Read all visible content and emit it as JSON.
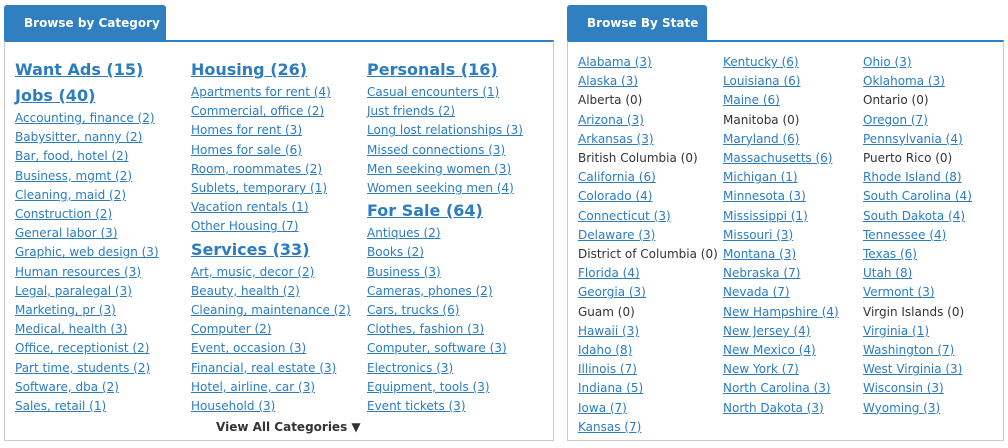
{
  "category_panel": {
    "tab_label": "Browse by Category",
    "view_all_label": "View All Categories",
    "columns": [
      [
        {
          "heading": "Want Ads (15)",
          "items": []
        },
        {
          "heading": "Jobs (40)",
          "items": [
            "Accounting, finance (2)",
            "Babysitter, nanny (2)",
            "Bar, food, hotel (2)",
            "Business, mgmt (2)",
            "Cleaning, maid (2)",
            "Construction (2)",
            "General labor (3)",
            "Graphic, web design (3)",
            "Human resources (3)",
            "Legal, paralegal (3)",
            "Marketing, pr (3)",
            "Medical, health (3)",
            "Office, receptionist (2)",
            "Part time, students (2)",
            "Software, dba (2)",
            "Sales, retail (1)"
          ]
        }
      ],
      [
        {
          "heading": "Housing (26)",
          "items": [
            "Apartments for rent (4)",
            "Commercial, office (2)",
            "Homes for rent (3)",
            "Homes for sale (6)",
            "Room, roommates (2)",
            "Sublets, temporary (1)",
            "Vacation rentals (1)",
            "Other Housing (7)"
          ]
        },
        {
          "heading": "Services (33)",
          "items": [
            "Art, music, decor (2)",
            "Beauty, health (2)",
            "Cleaning, maintenance (2)",
            "Computer (2)",
            "Event, occasion (3)",
            "Financial, real estate (3)",
            "Hotel, airline, car (3)",
            "Household (3)"
          ]
        }
      ],
      [
        {
          "heading": "Personals (16)",
          "items": [
            "Casual encounters (1)",
            "Just friends (2)",
            "Long lost relationships (3)",
            "Missed connections (3)",
            "Men seeking women (3)",
            "Women seeking men (4)"
          ]
        },
        {
          "heading": "For Sale (64)",
          "items": [
            "Antiques (2)",
            "Books (2)",
            "Business (3)",
            "Cameras, phones (2)",
            "Cars, trucks (6)",
            "Clothes, fashion (3)",
            "Computer, software (3)",
            "Electronics (3)",
            "Equipment, tools (3)",
            "Event tickets (3)"
          ]
        }
      ]
    ]
  },
  "state_panel": {
    "tab_label": "Browse By State",
    "columns": [
      [
        {
          "label": "Alabama (3)",
          "link": true
        },
        {
          "label": "Alaska (3)",
          "link": true
        },
        {
          "label": "Alberta (0)",
          "link": false
        },
        {
          "label": "Arizona (3)",
          "link": true
        },
        {
          "label": "Arkansas (3)",
          "link": true
        },
        {
          "label": "British Columbia (0)",
          "link": false
        },
        {
          "label": "California (6)",
          "link": true
        },
        {
          "label": "Colorado (4)",
          "link": true
        },
        {
          "label": "Connecticut (3)",
          "link": true
        },
        {
          "label": "Delaware (3)",
          "link": true
        },
        {
          "label": "District of Columbia (0)",
          "link": false
        },
        {
          "label": "Florida (4)",
          "link": true
        },
        {
          "label": "Georgia (3)",
          "link": true
        },
        {
          "label": "Guam (0)",
          "link": false
        },
        {
          "label": "Hawaii (3)",
          "link": true
        },
        {
          "label": "Idaho (8)",
          "link": true
        },
        {
          "label": "Illinois (7)",
          "link": true
        },
        {
          "label": "Indiana (5)",
          "link": true
        },
        {
          "label": "Iowa (7)",
          "link": true
        },
        {
          "label": "Kansas (7)",
          "link": true
        }
      ],
      [
        {
          "label": "Kentucky (6)",
          "link": true
        },
        {
          "label": "Louisiana (6)",
          "link": true
        },
        {
          "label": "Maine (6)",
          "link": true
        },
        {
          "label": "Manitoba (0)",
          "link": false
        },
        {
          "label": "Maryland (6)",
          "link": true
        },
        {
          "label": "Massachusetts (6)",
          "link": true
        },
        {
          "label": "Michigan (1)",
          "link": true
        },
        {
          "label": "Minnesota (3)",
          "link": true
        },
        {
          "label": "Mississippi (1)",
          "link": true
        },
        {
          "label": "Missouri (3)",
          "link": true
        },
        {
          "label": "Montana (3)",
          "link": true
        },
        {
          "label": "Nebraska (7)",
          "link": true
        },
        {
          "label": "Nevada (7)",
          "link": true
        },
        {
          "label": "New Hampshire (4)",
          "link": true
        },
        {
          "label": "New Jersey (4)",
          "link": true
        },
        {
          "label": "New Mexico (4)",
          "link": true
        },
        {
          "label": "New York (7)",
          "link": true
        },
        {
          "label": "North Carolina (3)",
          "link": true
        },
        {
          "label": "North Dakota (3)",
          "link": true
        }
      ],
      [
        {
          "label": "Ohio (3)",
          "link": true
        },
        {
          "label": "Oklahoma (3)",
          "link": true
        },
        {
          "label": "Ontario (0)",
          "link": false
        },
        {
          "label": "Oregon (7)",
          "link": true
        },
        {
          "label": "Pennsylvania (4)",
          "link": true
        },
        {
          "label": "Puerto Rico (0)",
          "link": false
        },
        {
          "label": "Rhode Island (8)",
          "link": true
        },
        {
          "label": "South Carolina (4)",
          "link": true
        },
        {
          "label": "South Dakota (4)",
          "link": true
        },
        {
          "label": "Tennessee (4)",
          "link": true
        },
        {
          "label": "Texas (6)",
          "link": true
        },
        {
          "label": "Utah (8)",
          "link": true
        },
        {
          "label": "Vermont (3)",
          "link": true
        },
        {
          "label": "Virgin Islands (0)",
          "link": false
        },
        {
          "label": "Virginia (1)",
          "link": true
        },
        {
          "label": "Washington (7)",
          "link": true
        },
        {
          "label": "West Virginia (3)",
          "link": true
        },
        {
          "label": "Wisconsin (3)",
          "link": true
        },
        {
          "label": "Wyoming (3)",
          "link": true
        }
      ]
    ]
  }
}
